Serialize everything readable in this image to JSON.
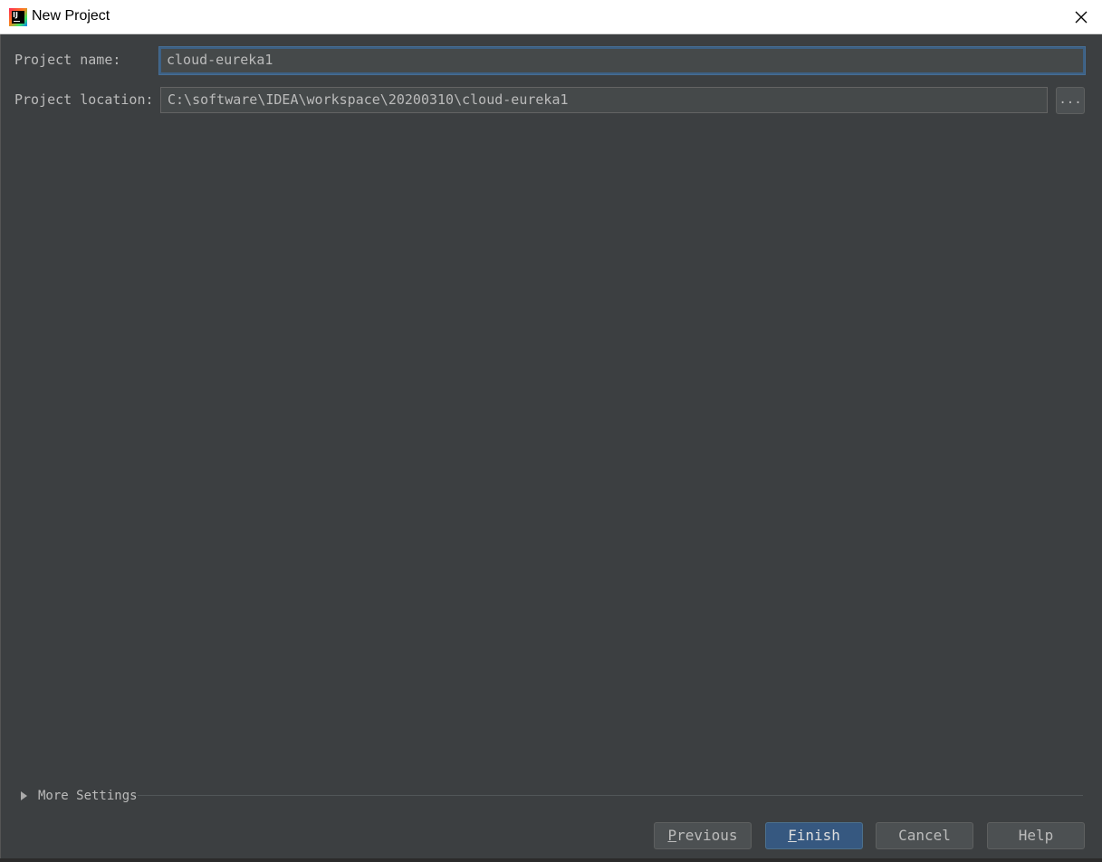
{
  "window": {
    "title": "New Project"
  },
  "form": {
    "name_label": "Project name:",
    "name_value": "cloud-eureka1",
    "location_label": "Project location:",
    "location_value": "C:\\software\\IDEA\\workspace\\20200310\\cloud-eureka1",
    "browse_label": "..."
  },
  "more_settings": {
    "label": "More Settings",
    "expanded": false
  },
  "buttons": {
    "previous": {
      "mnemonic": "P",
      "rest": "revious"
    },
    "finish": {
      "mnemonic": "F",
      "rest": "inish"
    },
    "cancel": "Cancel",
    "help": "Help"
  },
  "colors": {
    "dialog_bg": "#3c3f41",
    "field_bg": "#45494a",
    "focus_border": "#3d6185",
    "default_button": "#365880"
  },
  "icons": {
    "app": "intellij-idea-icon",
    "close": "close-icon",
    "expand": "triangle-right-icon"
  }
}
